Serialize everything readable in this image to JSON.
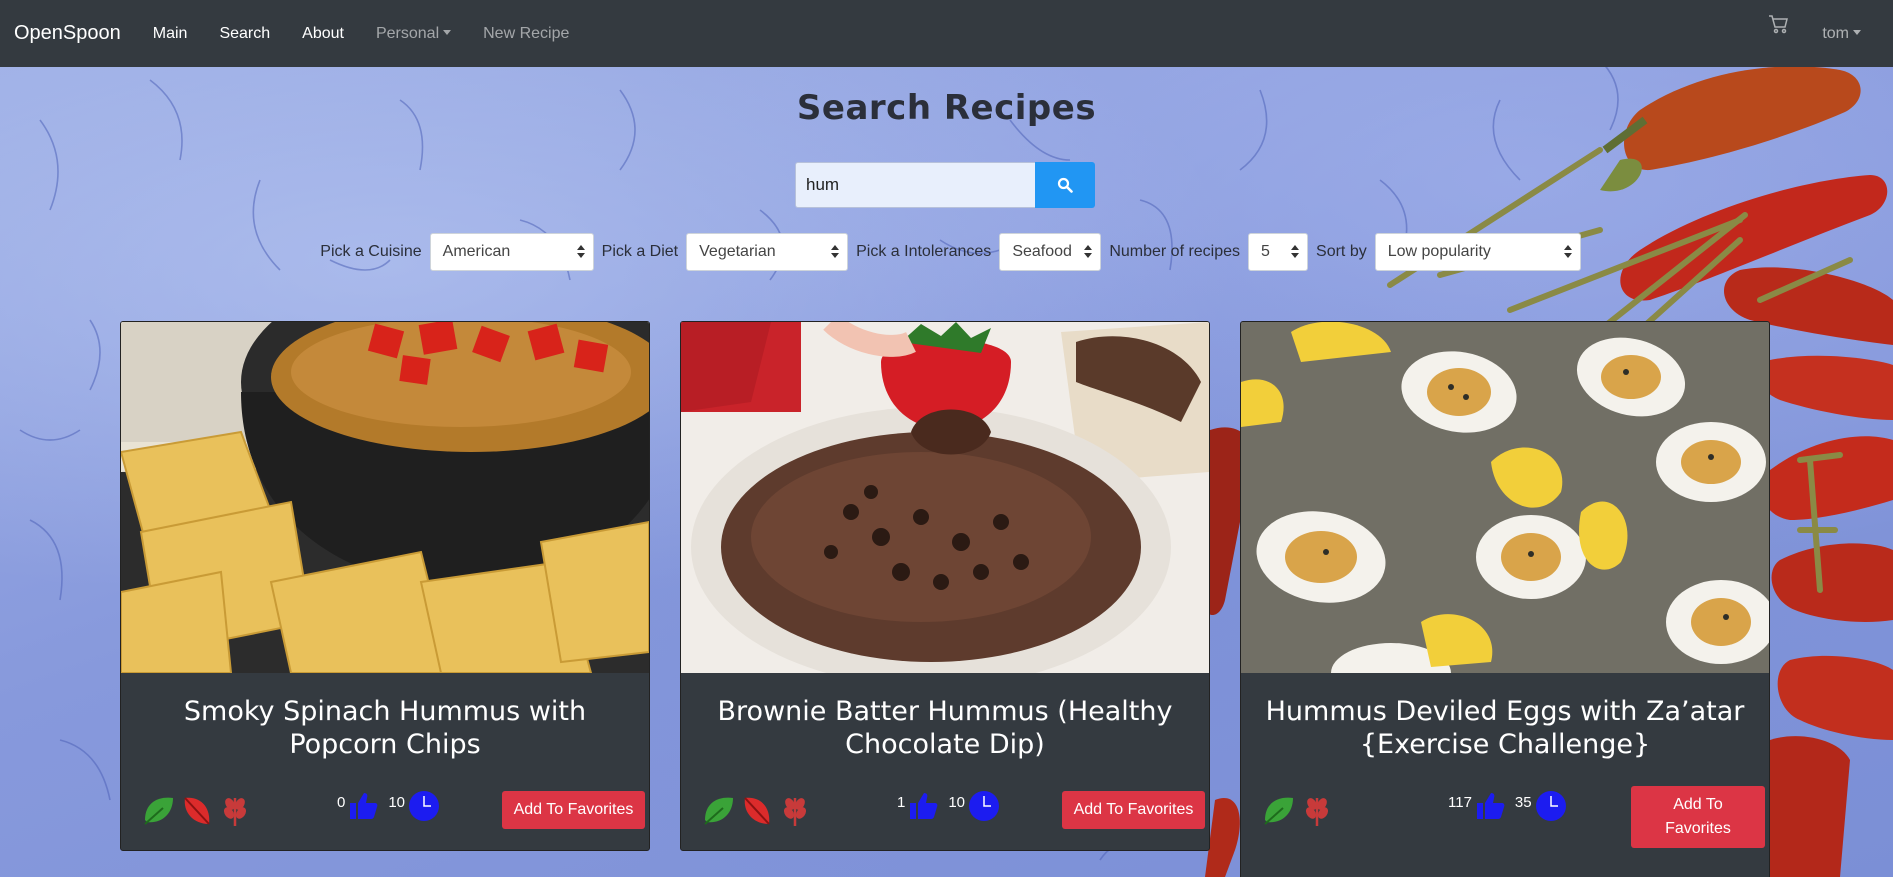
{
  "navbar": {
    "brand": "OpenSpoon",
    "links": [
      "Main",
      "Search",
      "About"
    ],
    "personal": "Personal",
    "new_recipe": "New Recipe",
    "user": "tom"
  },
  "page": {
    "title": "Search Recipes"
  },
  "search": {
    "value": "hum"
  },
  "filters": {
    "cuisine_label": "Pick a Cuisine",
    "cuisine_value": "American",
    "diet_label": "Pick a Diet",
    "diet_value": "Vegetarian",
    "intolerance_label": "Pick a Intolerances",
    "intolerance_value": "Seafood",
    "count_label": "Number of recipes",
    "count_value": "5",
    "sort_label": "Sort by",
    "sort_value": "Low popularity"
  },
  "cards": [
    {
      "title": "Smoky Spinach Hummus with Popcorn Chips",
      "likes": "0",
      "minutes": "10",
      "button": "Add To Favorites",
      "diet_icons": [
        "vegan-leaf-icon",
        "vegetarian-leaf-icon",
        "gluten-free-wheat-icon"
      ]
    },
    {
      "title": "Brownie Batter Hummus (Healthy Chocolate Dip)",
      "likes": "1",
      "minutes": "10",
      "button": "Add To Favorites",
      "diet_icons": [
        "vegan-leaf-icon",
        "vegetarian-leaf-icon",
        "gluten-free-wheat-icon"
      ]
    },
    {
      "title": "Hummus Deviled Eggs with Za’atar {Exercise Challenge}",
      "likes": "117",
      "minutes": "35",
      "button": "Add To Favorites",
      "diet_icons": [
        "vegan-leaf-icon",
        "gluten-free-wheat-icon"
      ]
    }
  ],
  "colors": {
    "navbar": "#343a40",
    "search_button": "#2196f3",
    "favorite_button": "#dc3545",
    "like_icon": "#1c1cf0"
  }
}
